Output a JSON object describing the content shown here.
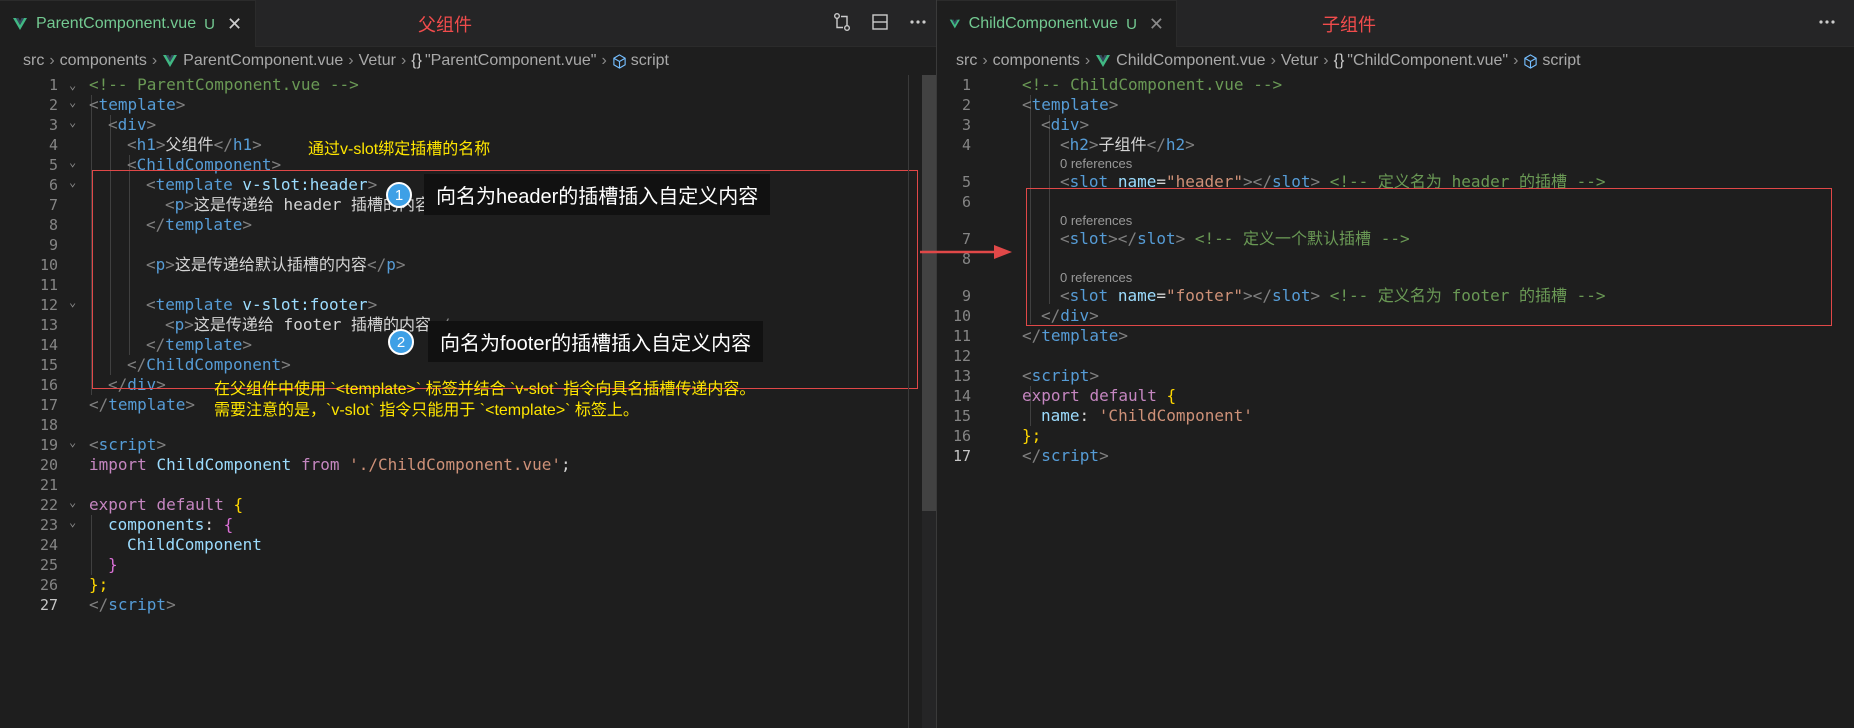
{
  "left": {
    "tab": {
      "name": "ParentComponent.vue",
      "status": "U",
      "close": "✕"
    },
    "label": "父组件",
    "breadcrumb": {
      "src": "src",
      "components": "components",
      "file": "ParentComponent.vue",
      "vetur": "Vetur",
      "braces": "{}",
      "component": "\"ParentComponent.vue\"",
      "script": "script"
    },
    "line_numbers": [
      "1",
      "2",
      "3",
      "4",
      "5",
      "6",
      "7",
      "8",
      "9",
      "10",
      "11",
      "12",
      "13",
      "14",
      "15",
      "16",
      "17",
      "18",
      "19",
      "20",
      "21",
      "22",
      "23",
      "24",
      "25",
      "26",
      "27"
    ],
    "code": {
      "l1": "<!-- ParentComponent.vue -->",
      "l2_tag": "template",
      "l3_tag": "div",
      "l4_tag": "h1",
      "l4_text": "父组件",
      "l5_tag": "ChildComponent",
      "l6_tag": "template",
      "l6_attr": "v-slot:header",
      "l7_tag": "p",
      "l7_text": "这是传递给 header 插槽的内容",
      "l8_tag": "template",
      "l10_tag": "p",
      "l10_text": "这是传递给默认插槽的内容",
      "l12_tag": "template",
      "l12_attr": "v-slot:footer",
      "l13_tag": "p",
      "l13_text": "这是传递给 footer 插槽的内容",
      "l14_tag": "template",
      "l15_tag": "ChildComponent",
      "l16_tag": "div",
      "l17_tag": "template",
      "l19_tag": "script",
      "l20_import": "import",
      "l20_name": "ChildComponent",
      "l20_from": "from",
      "l20_str": "'./ChildComponent.vue'",
      "l20_end": ";",
      "l22_export": "export",
      "l22_default": "default",
      "l22_brace": "{",
      "l23_key": "components",
      "l23_brace": "{",
      "l24_name": "ChildComponent",
      "l25_brace": "}",
      "l26_brace": "};",
      "l27_tag": "script"
    },
    "annotations": {
      "slot_name_note": "通过v-slot绑定插槽的名称",
      "callout1": "向名为header的插槽插入自定义内容",
      "callout2": "向名为footer的插槽插入自定义内容",
      "bubble1": "1",
      "bubble2": "2",
      "bottom_note": "在父组件中使用 `<template>` 标签并结合 `v-slot` 指令向具名插槽传递内容。\n需要注意的是，`v-slot` 指令只能用于 `<template>` 标签上。"
    }
  },
  "right": {
    "tab": {
      "name": "ChildComponent.vue",
      "status": "U",
      "close": "✕"
    },
    "label": "子组件",
    "breadcrumb": {
      "src": "src",
      "components": "components",
      "file": "ChildComponent.vue",
      "vetur": "Vetur",
      "braces": "{}",
      "component": "\"ChildComponent.vue\"",
      "script": "script"
    },
    "line_numbers": [
      "1",
      "2",
      "3",
      "4",
      "5",
      "6",
      "7",
      "8",
      "9",
      "10",
      "11",
      "12",
      "13",
      "14",
      "15",
      "16",
      "17"
    ],
    "refs": "0 references",
    "code": {
      "l1": "<!-- ChildComponent.vue -->",
      "l2_tag": "template",
      "l3_tag": "div",
      "l4_tag": "h2",
      "l4_text": "子组件",
      "l5_attr": "name",
      "l5_val": "\"header\"",
      "l5_com": "<!-- 定义名为 header 的插槽 -->",
      "l7_com": "<!-- 定义一个默认插槽 -->",
      "l9_attr": "name",
      "l9_val": "\"footer\"",
      "l9_com": "<!-- 定义名为 footer 的插槽 -->",
      "slot_tag": "slot",
      "l10_tag": "div",
      "l11_tag": "template",
      "l13_tag": "script",
      "l14_export": "export",
      "l14_default": "default",
      "l14_brace": "{",
      "l15_key": "name",
      "l15_val": "'ChildComponent'",
      "l16_brace": "};",
      "l17_tag": "script"
    }
  },
  "colors": {
    "accent_red": "#e04848",
    "annotation_yellow": "#ffe600",
    "bubble_blue": "#3ea0e6"
  }
}
